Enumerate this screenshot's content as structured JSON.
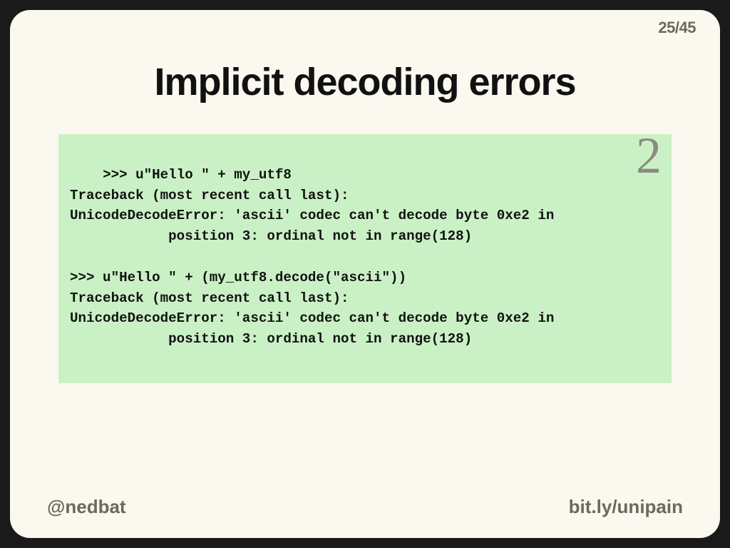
{
  "page": {
    "current": "25",
    "separator": "/",
    "total": "45"
  },
  "title": "Implicit decoding errors",
  "code": ">>> u\"Hello \" + my_utf8\nTraceback (most recent call last):\nUnicodeDecodeError: 'ascii' codec can't decode byte 0xe2 in\n            position 3: ordinal not in range(128)\n\n>>> u\"Hello \" + (my_utf8.decode(\"ascii\"))\nTraceback (most recent call last):\nUnicodeDecodeError: 'ascii' codec can't decode byte 0xe2 in\n            position 3: ordinal not in range(128)",
  "badge": "2",
  "footer": {
    "left": "@nedbat",
    "right": "bit.ly/unipain"
  }
}
